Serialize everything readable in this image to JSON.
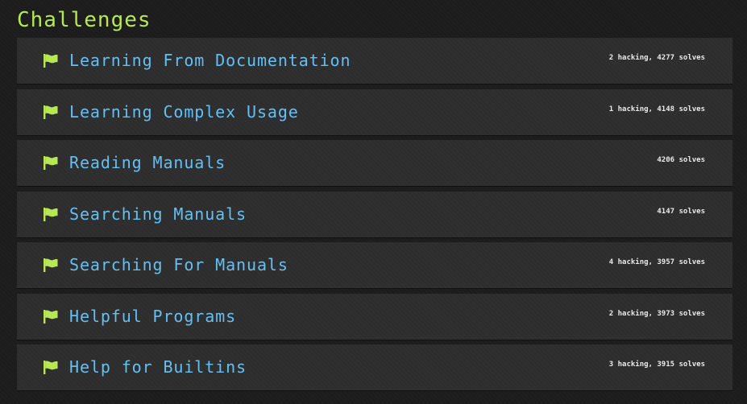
{
  "page": {
    "title": "Challenges"
  },
  "colors": {
    "accent": "#b5e853",
    "link": "#63c0f5",
    "stats": "#eaeaea",
    "panel": "#2d2d2d",
    "background": "#1c1c1c"
  },
  "challenges": [
    {
      "name": "Learning From Documentation",
      "stats": "2 hacking, 4277 solves",
      "icon": "flag-icon"
    },
    {
      "name": "Learning Complex Usage",
      "stats": "1 hacking, 4148 solves",
      "icon": "flag-icon"
    },
    {
      "name": "Reading Manuals",
      "stats": "4206 solves",
      "icon": "flag-icon"
    },
    {
      "name": "Searching Manuals",
      "stats": "4147 solves",
      "icon": "flag-icon"
    },
    {
      "name": "Searching For Manuals",
      "stats": "4 hacking, 3957 solves",
      "icon": "flag-icon"
    },
    {
      "name": "Helpful Programs",
      "stats": "2 hacking, 3973 solves",
      "icon": "flag-icon"
    },
    {
      "name": "Help for Builtins",
      "stats": "3 hacking, 3915 solves",
      "icon": "flag-icon"
    }
  ]
}
